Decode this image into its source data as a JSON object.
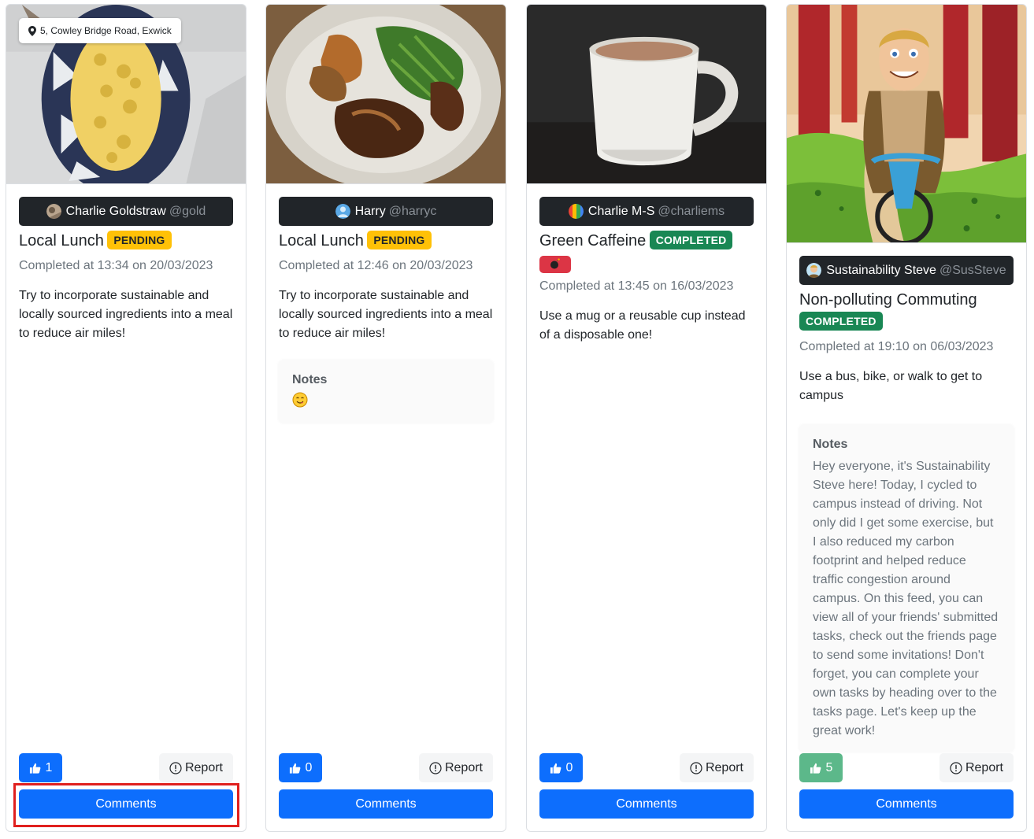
{
  "colors": {
    "primary": "#0d6efd",
    "pending": "#ffc107",
    "completed": "#198754",
    "liked": "#5cb88a",
    "dark_chip": "#212529",
    "highlight": "#e0201e"
  },
  "posts": [
    {
      "location": "5, Cowley Bridge Road, Exwick",
      "user": {
        "name": "Charlie Goldstraw",
        "handle": "@gold"
      },
      "task": "Local Lunch",
      "status": "PENDING",
      "time": "Completed at 13:34 on 20/03/2023",
      "description": "Try to incorporate sustainable and locally sourced ingredients into a meal to reduce air miles!",
      "likes": "1",
      "report_label": "Report",
      "comments_label": "Comments"
    },
    {
      "user": {
        "name": "Harry",
        "handle": "@harryc"
      },
      "task": "Local Lunch",
      "status": "PENDING",
      "time": "Completed at 12:46 on 20/03/2023",
      "description": "Try to incorporate sustainable and locally sourced ingredients into a meal to reduce air miles!",
      "notes_title": "Notes",
      "notes_icon": "yum-face-emoji",
      "likes": "0",
      "report_label": "Report",
      "comments_label": "Comments"
    },
    {
      "user": {
        "name": "Charlie M-S",
        "handle": "@charliems"
      },
      "task": "Green Caffeine",
      "status": "COMPLETED",
      "status_icon": "bomb-emoji",
      "time": "Completed at 13:45 on 16/03/2023",
      "description": "Use a mug or a reusable cup instead of a disposable one!",
      "likes": "0",
      "report_label": "Report",
      "comments_label": "Comments"
    },
    {
      "user": {
        "name": "Sustainability Steve",
        "handle": "@SusSteve"
      },
      "task": "Non-polluting Commuting",
      "status": "COMPLETED",
      "time": "Completed at 19:10 on 06/03/2023",
      "description": "Use a bus, bike, or walk to get to campus",
      "notes_title": "Notes",
      "notes": "Hey everyone, it's Sustainability Steve here! Today, I cycled to campus instead of driving. Not only did I get some exercise, but I also reduced my carbon footprint and helped reduce traffic congestion around campus. On this feed, you can view all of your friends' submitted tasks, check out the friends page to send some invitations! Don't forget, you can complete your own tasks by heading over to the tasks page. Let's keep up the great work!",
      "likes": "5",
      "report_label": "Report",
      "comments_label": "Comments"
    }
  ]
}
